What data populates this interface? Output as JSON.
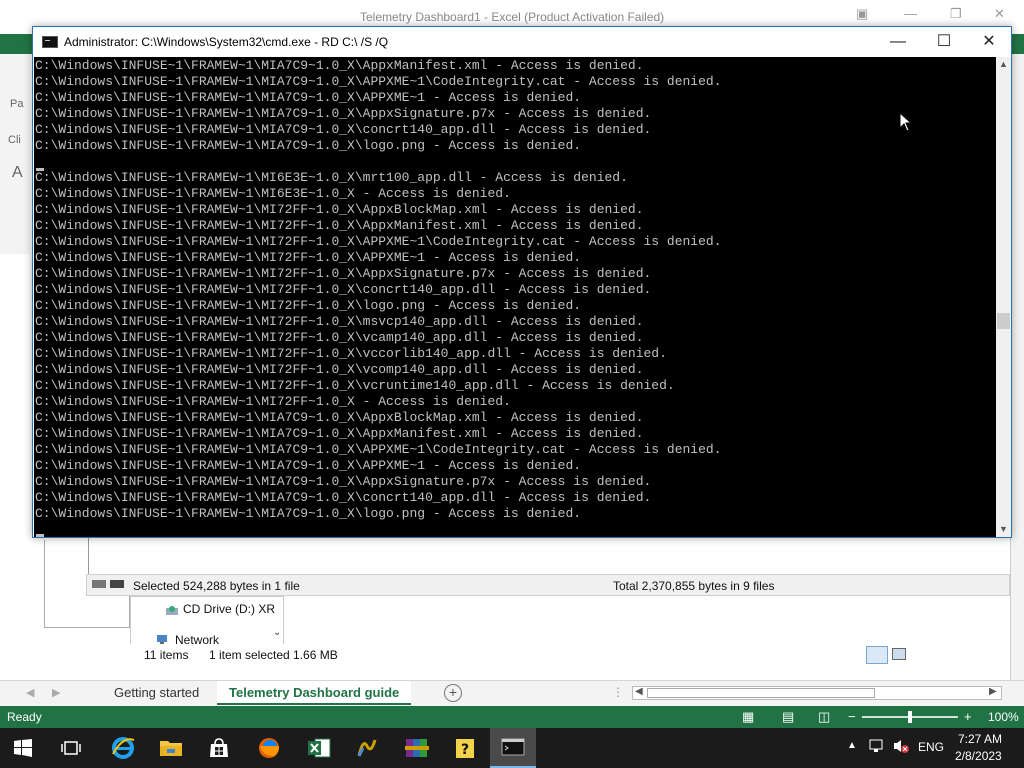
{
  "excel": {
    "title": "Telemetry Dashboard1 - Excel (Product Activation Failed)",
    "side_labels": [
      "Pa",
      "Cli",
      "A"
    ],
    "sheet_tabs": [
      {
        "label": "Getting started"
      },
      {
        "label": "Telemetry Dashboard guide"
      }
    ],
    "status": {
      "ready": "Ready",
      "zoom": "100%"
    },
    "colors": {
      "accent": "#217346"
    }
  },
  "explorer": {
    "selected_bytes": "Selected 524,288 bytes in 1 file",
    "total_bytes": "Total 2,370,855 bytes in 9 files",
    "tree": [
      "CD Drive (D:) XR",
      "Network"
    ],
    "item_count": "11 items",
    "item_selected": "1 item selected  1.66 MB"
  },
  "cmd": {
    "title": "Administrator: C:\\Windows\\System32\\cmd.exe - RD  C:\\ /S /Q",
    "lines": [
      "C:\\Windows\\INFUSE~1\\FRAMEW~1\\MIA7C9~1.0_X\\AppxManifest.xml - Access is denied.",
      "C:\\Windows\\INFUSE~1\\FRAMEW~1\\MIA7C9~1.0_X\\APPXME~1\\CodeIntegrity.cat - Access is denied.",
      "C:\\Windows\\INFUSE~1\\FRAMEW~1\\MIA7C9~1.0_X\\APPXME~1 - Access is denied.",
      "C:\\Windows\\INFUSE~1\\FRAMEW~1\\MIA7C9~1.0_X\\AppxSignature.p7x - Access is denied.",
      "C:\\Windows\\INFUSE~1\\FRAMEW~1\\MIA7C9~1.0_X\\concrt140_app.dll - Access is denied.",
      "C:\\Windows\\INFUSE~1\\FRAMEW~1\\MIA7C9~1.0_X\\logo.png - Access is denied.",
      "",
      "C:\\Windows\\INFUSE~1\\FRAMEW~1\\MI6E3E~1.0_X\\mrt100_app.dll - Access is denied.",
      "C:\\Windows\\INFUSE~1\\FRAMEW~1\\MI6E3E~1.0_X - Access is denied.",
      "C:\\Windows\\INFUSE~1\\FRAMEW~1\\MI72FF~1.0_X\\AppxBlockMap.xml - Access is denied.",
      "C:\\Windows\\INFUSE~1\\FRAMEW~1\\MI72FF~1.0_X\\AppxManifest.xml - Access is denied.",
      "C:\\Windows\\INFUSE~1\\FRAMEW~1\\MI72FF~1.0_X\\APPXME~1\\CodeIntegrity.cat - Access is denied.",
      "C:\\Windows\\INFUSE~1\\FRAMEW~1\\MI72FF~1.0_X\\APPXME~1 - Access is denied.",
      "C:\\Windows\\INFUSE~1\\FRAMEW~1\\MI72FF~1.0_X\\AppxSignature.p7x - Access is denied.",
      "C:\\Windows\\INFUSE~1\\FRAMEW~1\\MI72FF~1.0_X\\concrt140_app.dll - Access is denied.",
      "C:\\Windows\\INFUSE~1\\FRAMEW~1\\MI72FF~1.0_X\\logo.png - Access is denied.",
      "C:\\Windows\\INFUSE~1\\FRAMEW~1\\MI72FF~1.0_X\\msvcp140_app.dll - Access is denied.",
      "C:\\Windows\\INFUSE~1\\FRAMEW~1\\MI72FF~1.0_X\\vcamp140_app.dll - Access is denied.",
      "C:\\Windows\\INFUSE~1\\FRAMEW~1\\MI72FF~1.0_X\\vccorlib140_app.dll - Access is denied.",
      "C:\\Windows\\INFUSE~1\\FRAMEW~1\\MI72FF~1.0_X\\vcomp140_app.dll - Access is denied.",
      "C:\\Windows\\INFUSE~1\\FRAMEW~1\\MI72FF~1.0_X\\vcruntime140_app.dll - Access is denied.",
      "C:\\Windows\\INFUSE~1\\FRAMEW~1\\MI72FF~1.0_X - Access is denied.",
      "C:\\Windows\\INFUSE~1\\FRAMEW~1\\MIA7C9~1.0_X\\AppxBlockMap.xml - Access is denied.",
      "C:\\Windows\\INFUSE~1\\FRAMEW~1\\MIA7C9~1.0_X\\AppxManifest.xml - Access is denied.",
      "C:\\Windows\\INFUSE~1\\FRAMEW~1\\MIA7C9~1.0_X\\APPXME~1\\CodeIntegrity.cat - Access is denied.",
      "C:\\Windows\\INFUSE~1\\FRAMEW~1\\MIA7C9~1.0_X\\APPXME~1 - Access is denied.",
      "C:\\Windows\\INFUSE~1\\FRAMEW~1\\MIA7C9~1.0_X\\AppxSignature.p7x - Access is denied.",
      "C:\\Windows\\INFUSE~1\\FRAMEW~1\\MIA7C9~1.0_X\\concrt140_app.dll - Access is denied.",
      "C:\\Windows\\INFUSE~1\\FRAMEW~1\\MIA7C9~1.0_X\\logo.png - Access is denied."
    ],
    "colors": {
      "background": "#000000",
      "text": "#c0c0c0"
    }
  },
  "taskbar": {
    "apps": [
      "start-icon",
      "task-view-icon",
      "internet-explorer-icon",
      "file-explorer-icon",
      "store-icon",
      "firefox-icon",
      "excel-icon",
      "winscp-icon",
      "winrar-icon",
      "help-icon",
      "cmd-icon"
    ],
    "tray": {
      "language": "ENG",
      "time": "7:27 AM",
      "date": "2/8/2023"
    },
    "colors": {
      "background": "#1b1b1b",
      "active": "#76b9ed"
    }
  }
}
